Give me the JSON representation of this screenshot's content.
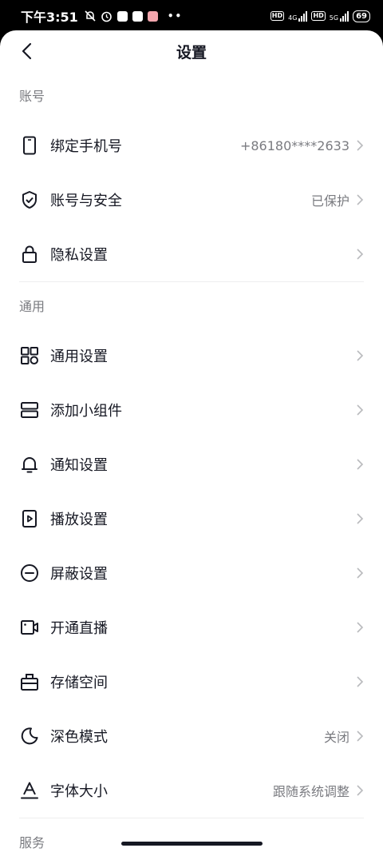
{
  "status_bar": {
    "time": "下午3:51",
    "net1": "4G",
    "net2": "5G",
    "hd": "HD",
    "battery": "69"
  },
  "header": {
    "title": "设置"
  },
  "sections": {
    "account": {
      "title": "账号",
      "items": [
        {
          "label": "绑定手机号",
          "value": "+86180****2633",
          "icon": "phone-icon"
        },
        {
          "label": "账号与安全",
          "value": "已保护",
          "icon": "shield-check-icon"
        },
        {
          "label": "隐私设置",
          "value": "",
          "icon": "lock-icon"
        }
      ]
    },
    "general": {
      "title": "通用",
      "items": [
        {
          "label": "通用设置",
          "value": "",
          "icon": "grid-icon"
        },
        {
          "label": "添加小组件",
          "value": "",
          "icon": "widget-icon"
        },
        {
          "label": "通知设置",
          "value": "",
          "icon": "bell-icon"
        },
        {
          "label": "播放设置",
          "value": "",
          "icon": "play-icon"
        },
        {
          "label": "屏蔽设置",
          "value": "",
          "icon": "block-icon"
        },
        {
          "label": "开通直播",
          "value": "",
          "icon": "video-camera-icon"
        },
        {
          "label": "存储空间",
          "value": "",
          "icon": "storage-icon"
        },
        {
          "label": "深色模式",
          "value": "关闭",
          "icon": "moon-icon"
        },
        {
          "label": "字体大小",
          "value": "跟随系统调整",
          "icon": "font-size-icon"
        }
      ]
    },
    "service": {
      "title": "服务"
    }
  },
  "colors": {
    "text": "#161823",
    "secondary": "#7a7b80",
    "divider": "#eeeeef"
  }
}
